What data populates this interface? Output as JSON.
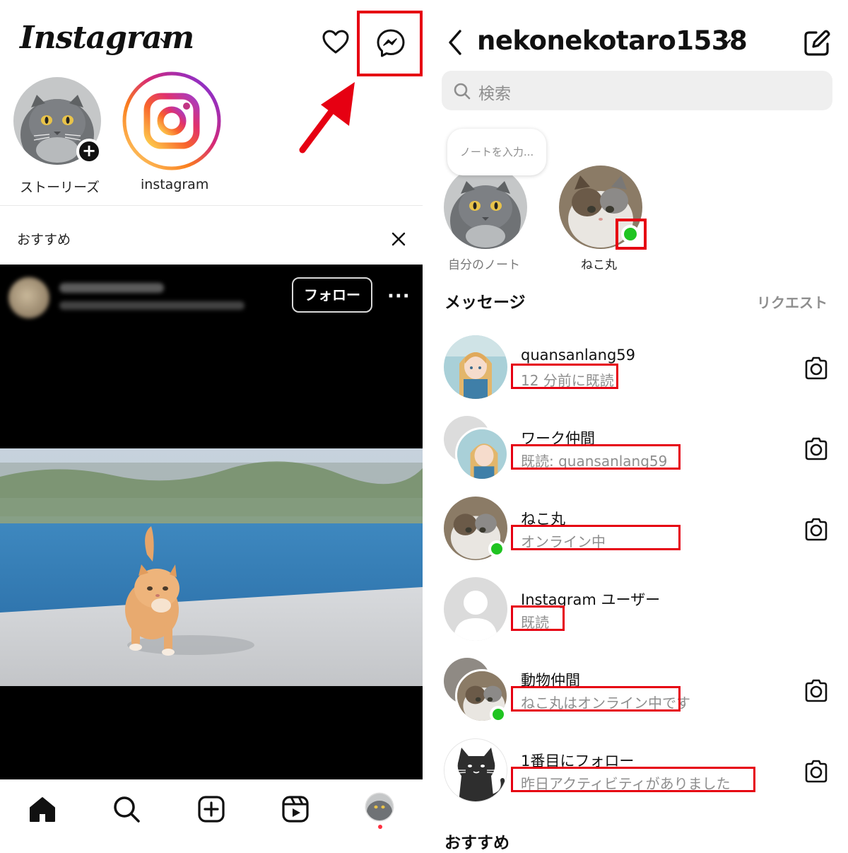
{
  "left": {
    "logo": "Instagram",
    "stories": [
      {
        "label": "ストーリーズ",
        "avatar": "gray-scottish-fold-cat"
      },
      {
        "label": "instagram",
        "avatar": "instagram-logo"
      }
    ],
    "recommend_label": "おすすめ",
    "post": {
      "follow_label": "フォロー",
      "more_label": "···",
      "image": "orange-kitten-walking-by-sea"
    },
    "nav": [
      "home-icon",
      "search-icon",
      "create-icon",
      "reels-icon",
      "profile-avatar"
    ]
  },
  "right": {
    "account": "nekonekotaro1538",
    "search_placeholder": "検索",
    "note_placeholder": "ノートを入力...",
    "notes": [
      {
        "label": "自分のノート",
        "avatar": "gray-scottish-fold-cat"
      },
      {
        "label": "ねこ丸",
        "avatar": "calico-kitten",
        "online": true
      }
    ],
    "messages_heading": "メッセージ",
    "requests_label": "リクエスト",
    "threads": [
      {
        "name": "quansanlang59",
        "status": "12 分前に既読",
        "avatar": "anime-girl",
        "online": false
      },
      {
        "name": "ワーク仲間",
        "status": "既読: quansanlang59",
        "avatar": "group-anime-girl",
        "online": false
      },
      {
        "name": "ねこ丸",
        "status": "オンライン中",
        "avatar": "calico-kitten",
        "online": true
      },
      {
        "name": "Instagram ユーザー",
        "status": "既読",
        "avatar": "default-user",
        "online": false
      },
      {
        "name": "動物仲間",
        "status": "ねこ丸はオンライン中です",
        "avatar": "group-calico-kitten",
        "online": true
      },
      {
        "name": "1番目にフォロー",
        "status": "昨日アクティビティがありました",
        "avatar": "black-cat-illustration",
        "online": false
      }
    ],
    "suggested_heading": "おすすめ"
  },
  "annotation_color": "#e60012",
  "online_color": "#1fc421"
}
